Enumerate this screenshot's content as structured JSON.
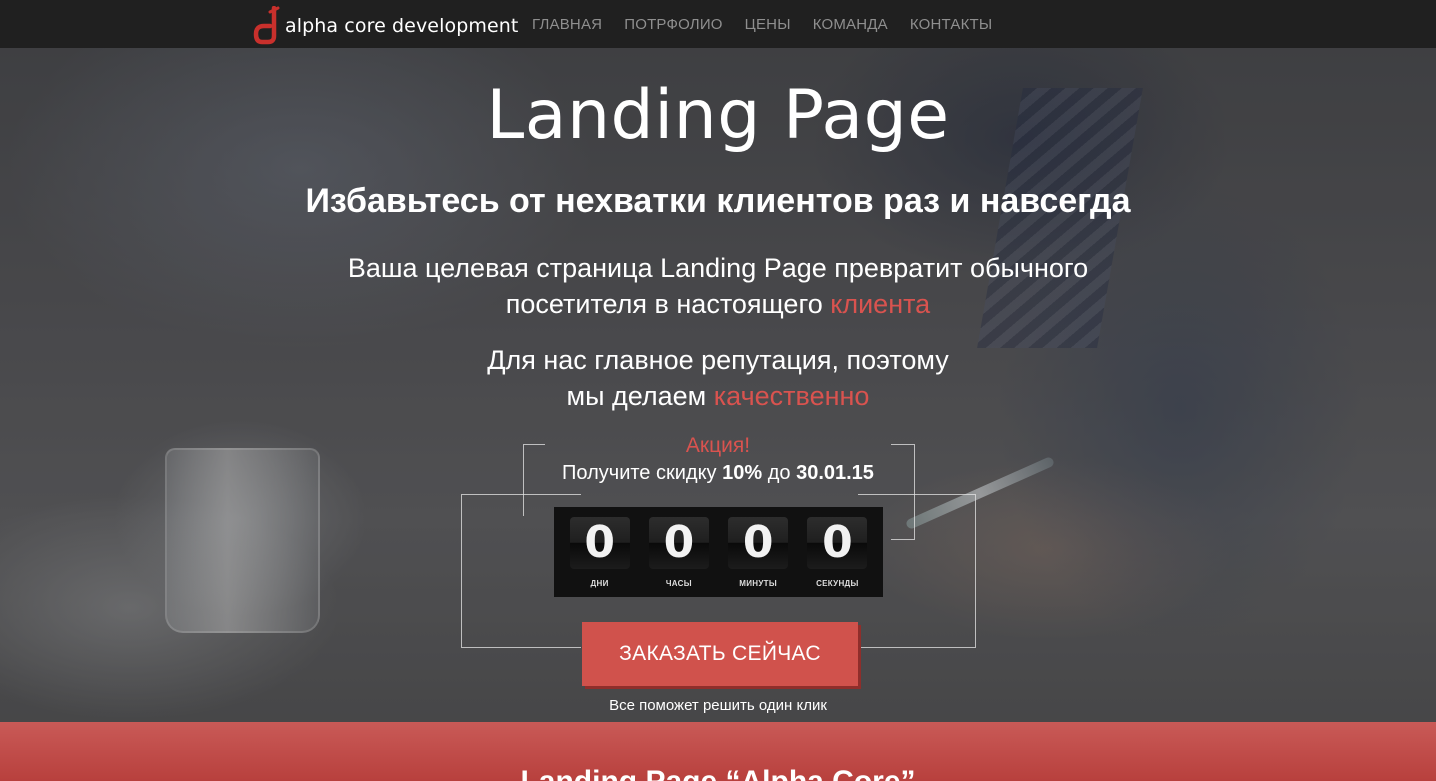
{
  "navbar": {
    "brand": "alpha core development",
    "links": [
      "ГЛАВНАЯ",
      "ПОТРФОЛИО",
      "ЦЕНЫ",
      "КОМАНДА",
      "КОНТАКТЫ"
    ]
  },
  "hero": {
    "title": "Landing Page",
    "subtitle": "Избавьтесь от нехватки клиентов раз и навсегда",
    "desc_line1": "Ваша целевая страница Landing Page превратит обычного",
    "desc_line2": "посетителя в настоящего",
    "desc_accent": "клиента",
    "rep_line1": "Для нас главное репутация, поэтому",
    "rep_line2": "мы делаем",
    "rep_accent": "качественно"
  },
  "promo": {
    "label": "Акция!",
    "text_prefix": "Получите скидку",
    "discount": "10%",
    "text_middle": "до",
    "date": "30.01.15"
  },
  "countdown": {
    "units": [
      {
        "value": "0",
        "label": "ДНИ"
      },
      {
        "value": "0",
        "label": "ЧАСЫ"
      },
      {
        "value": "0",
        "label": "МИНУТЫ"
      },
      {
        "value": "0",
        "label": "СЕКУНДЫ"
      }
    ]
  },
  "cta": {
    "button": "ЗАКАЗАТЬ СЕЙЧАС",
    "note": "Все поможет решить один клик"
  },
  "band": {
    "title": "Landing Page “Alpha Core”"
  },
  "colors": {
    "accent": "#d9534f",
    "navbar": "#202020",
    "button": "#d0524c"
  }
}
